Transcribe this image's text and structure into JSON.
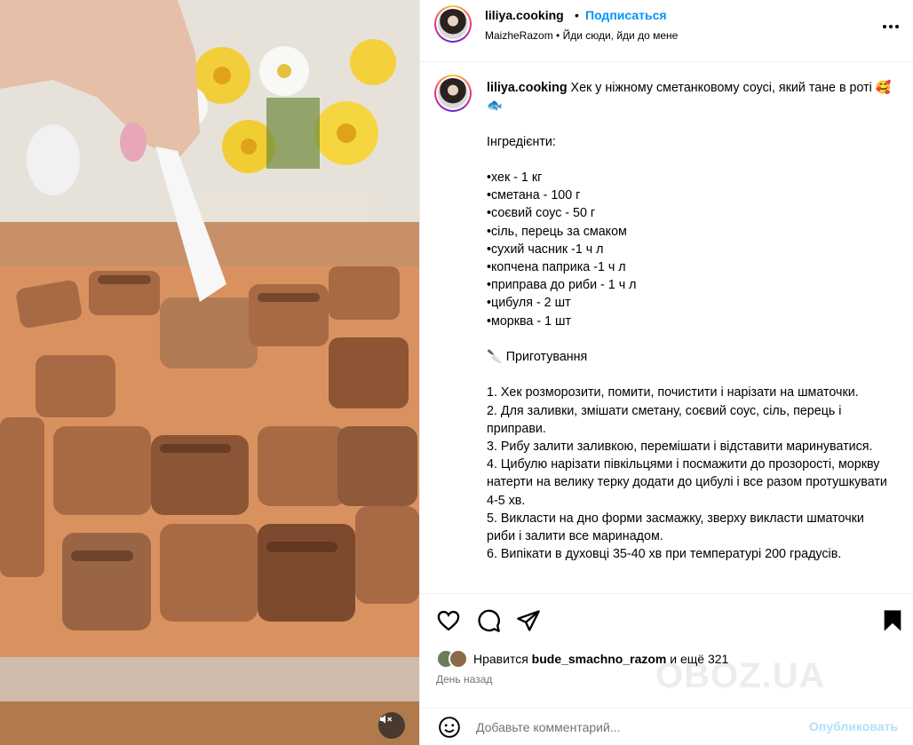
{
  "header": {
    "username": "liliya.cooking",
    "separator": "•",
    "follow_label": "Подписаться",
    "audio": "MaizheRazom • Йди сюди, йди до мене",
    "more_icon": "more-horizontal-icon"
  },
  "caption": {
    "username": "liliya.cooking",
    "text": " Хек у ніжному сметанковому соусі, який тане в роті 🥰 🐟\n\nІнгредієнти:\n\n•хек - 1 кг\n•сметана - 100 г\n•соєвий соус - 50 г\n•сіль, перець за смаком\n•сухий часник -1 ч л\n•копчена паприка -1 ч л\n•приправа до риби - 1 ч л\n•цибуля - 2 шт\n•морква - 1 шт\n\n🔪 Приготування\n\n1. Хек розморозити, помити, почистити і нарізати на шматочки.\n2. Для заливки, змішати сметану, соєвий соус, сіль, перець і приправи.\n3. Рибу залити заливкою, перемішати і відставити маринуватися.\n4. Цибулю нарізати півкільцями і посмажити до прозорості, моркву натерти на велику терку додати до цибулі і все разом протушкувати 4-5 хв.\n5. Викласти на дно форми засмажку, зверху викласти шматочки риби і залити все маринадом.\n6. Випікати в духовці 35-40 хв при температурі 200 градусів."
  },
  "actions": {
    "like_icon": "heart-icon",
    "comment_icon": "comment-icon",
    "share_icon": "paper-plane-icon",
    "save_icon": "bookmark-icon"
  },
  "likes": {
    "prefix": "Нравится ",
    "user": "bude_smachno_razom",
    "suffix": " и ещё 321"
  },
  "time_ago": "День назад",
  "comment": {
    "placeholder": "Добавьте комментарий...",
    "post_label": "Опубликовать",
    "emoji_icon": "smiley-icon"
  },
  "media": {
    "mute_icon": "speaker-muted-icon"
  },
  "watermark": "OBOZ.UA",
  "colors": {
    "accent": "#0095f6",
    "post_disabled": "#b2dffc",
    "muted_text": "#737373"
  }
}
